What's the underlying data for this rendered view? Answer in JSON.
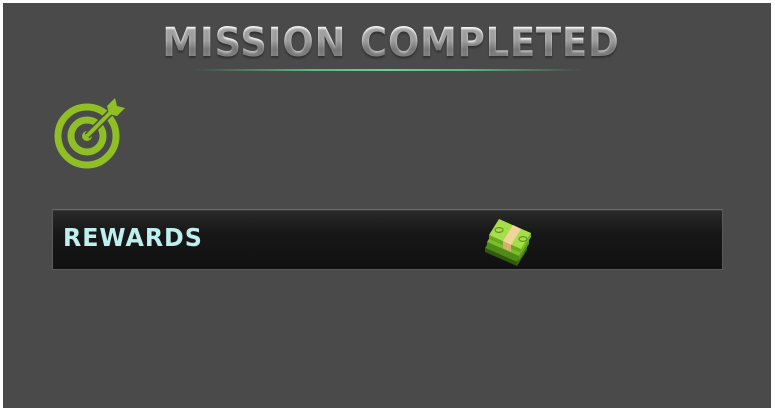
{
  "header": {
    "title": "MISSION COMPLETED"
  },
  "objective": {
    "icon": "target-icon",
    "icon_color": "#8fbf25"
  },
  "rewards": {
    "label": "REWARDS",
    "label_color": "#bfeeee",
    "items": [
      {
        "icon": "cash-stack-icon"
      }
    ]
  },
  "colors": {
    "background": "#4a4a4a",
    "bar": "#151515",
    "accent_line": "#4cbf84"
  }
}
